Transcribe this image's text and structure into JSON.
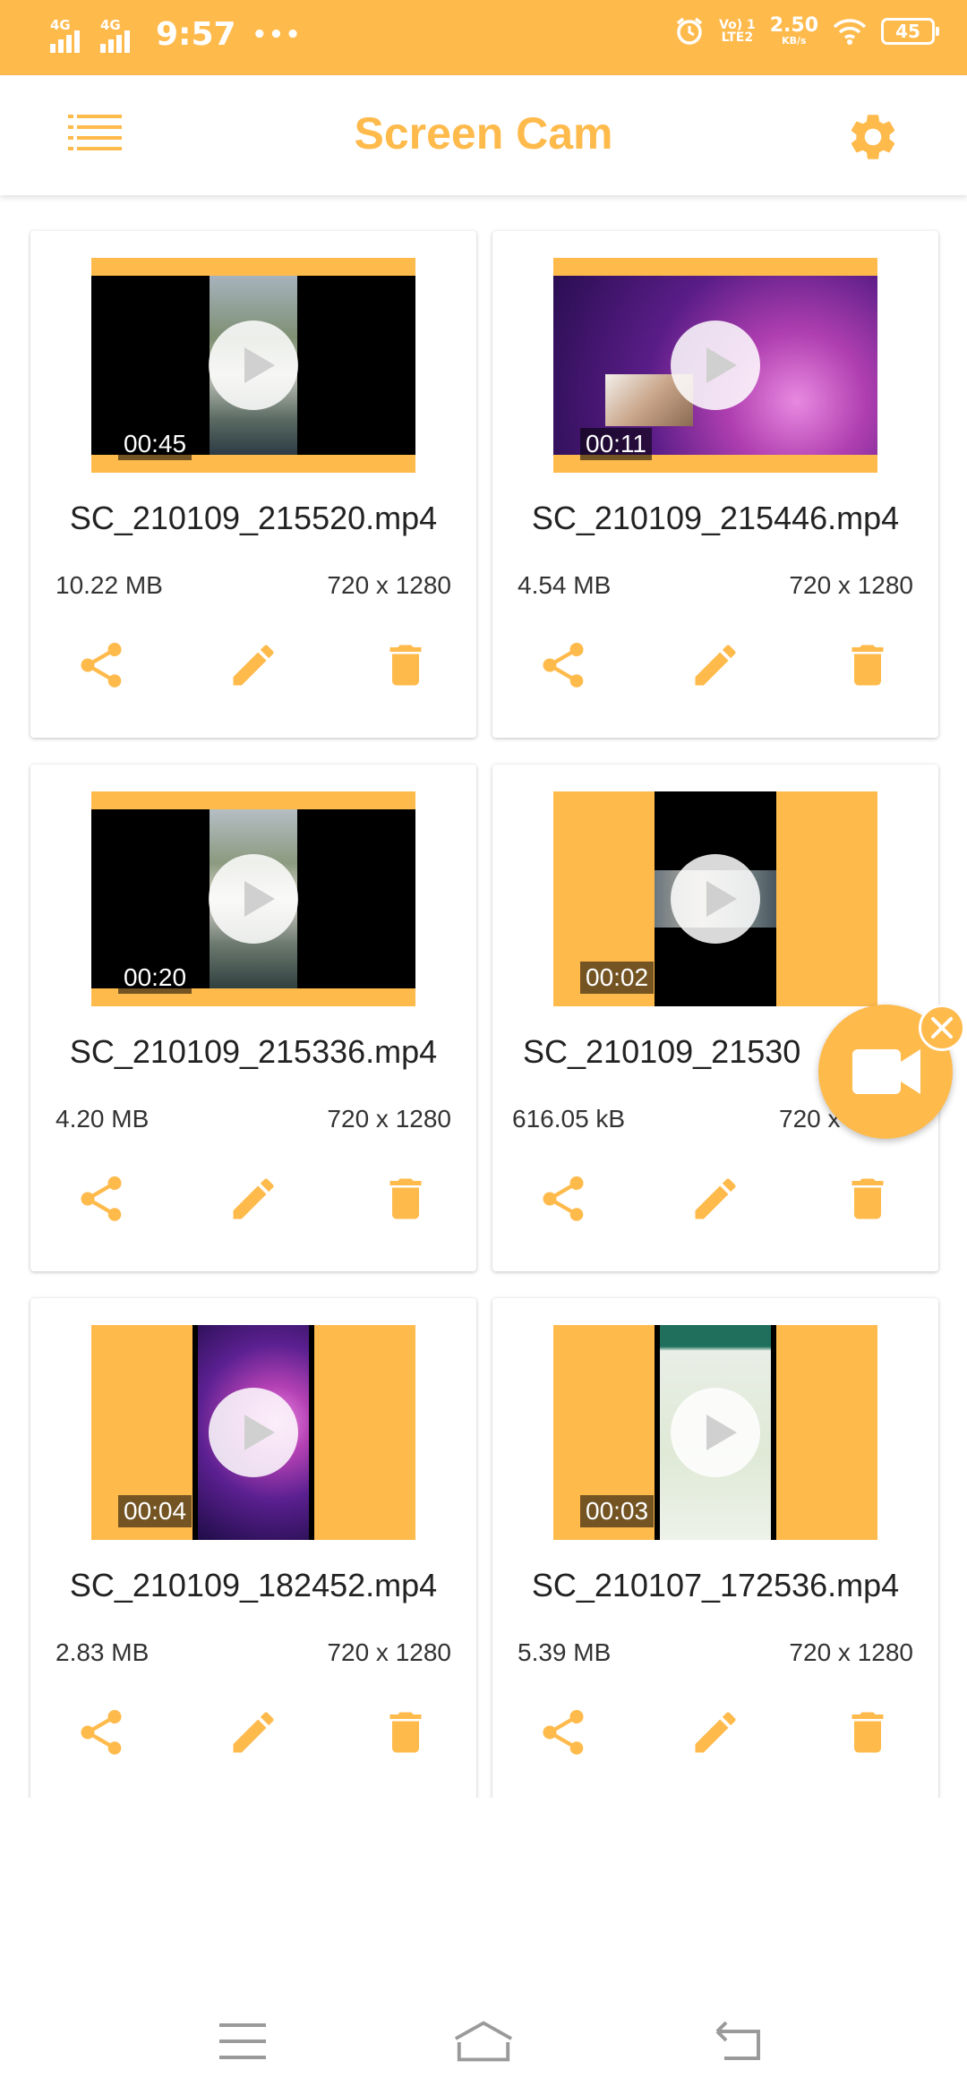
{
  "status_bar": {
    "network_1": "4G",
    "network_2": "4G",
    "time": "9:57",
    "dots": "•••",
    "volte_top": "Vo) 1",
    "volte_bottom": "LTE2",
    "speed_value": "2.50",
    "speed_unit": "KB/s",
    "battery": "45"
  },
  "app_bar": {
    "title": "Screen Cam",
    "menu_icon": "list-menu-icon",
    "settings_icon": "gear-icon"
  },
  "colors": {
    "accent": "#FFBA4C",
    "text": "#222222"
  },
  "videos": [
    {
      "name": "SC_210109_215520.mp4",
      "size": "10.22 MB",
      "resolution": "720 x 1280",
      "duration": "00:45"
    },
    {
      "name": "SC_210109_215446.mp4",
      "size": "4.54 MB",
      "resolution": "720 x 1280",
      "duration": "00:11"
    },
    {
      "name": "SC_210109_215336.mp4",
      "size": "4.20 MB",
      "resolution": "720 x 1280",
      "duration": "00:20"
    },
    {
      "name": "SC_210109_21530",
      "size": "616.05 kB",
      "resolution": "720 x",
      "duration": "00:02"
    },
    {
      "name": "SC_210109_182452.mp4",
      "size": "2.83 MB",
      "resolution": "720 x 1280",
      "duration": "00:04"
    },
    {
      "name": "SC_210107_172536.mp4",
      "size": "5.39 MB",
      "resolution": "720 x 1280",
      "duration": "00:03"
    }
  ],
  "card_actions": [
    "share-icon",
    "edit-pencil-icon",
    "delete-trash-icon"
  ],
  "floating_button": {
    "icon": "video-camera-icon",
    "close_icon": "close-icon"
  },
  "nav_bar": [
    "recents-menu-icon",
    "home-icon",
    "back-icon"
  ]
}
